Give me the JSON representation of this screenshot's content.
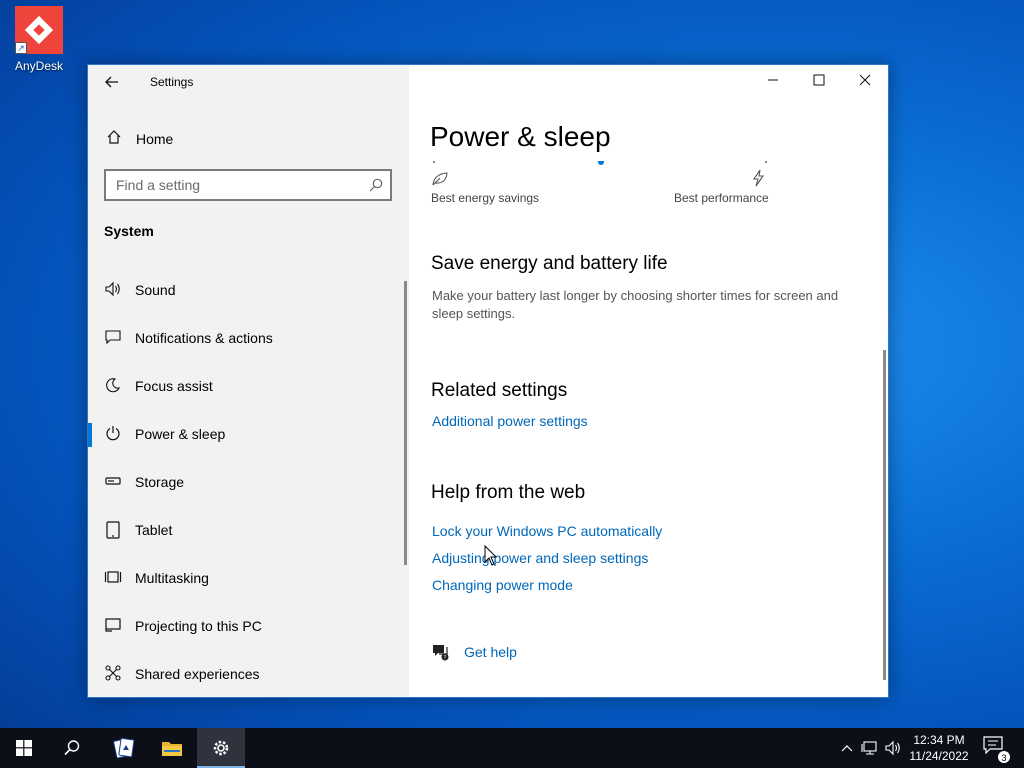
{
  "desktop": {
    "icons": [
      {
        "label": "AnyDesk",
        "icon": "anydesk-icon"
      }
    ]
  },
  "window": {
    "title": "Settings",
    "controls": {
      "minimize": "—",
      "maximize": "☐",
      "close": "✕"
    }
  },
  "sidebar": {
    "home_label": "Home",
    "search_placeholder": "Find a setting",
    "section_label": "System",
    "items": [
      {
        "label": "Sound",
        "icon": "speaker-icon",
        "active": false
      },
      {
        "label": "Notifications & actions",
        "icon": "notification-icon",
        "active": false
      },
      {
        "label": "Focus assist",
        "icon": "moon-icon",
        "active": false
      },
      {
        "label": "Power & sleep",
        "icon": "power-icon",
        "active": true
      },
      {
        "label": "Storage",
        "icon": "storage-icon",
        "active": false
      },
      {
        "label": "Tablet",
        "icon": "tablet-icon",
        "active": false
      },
      {
        "label": "Multitasking",
        "icon": "multitasking-icon",
        "active": false
      },
      {
        "label": "Projecting to this PC",
        "icon": "projector-icon",
        "active": false
      },
      {
        "label": "Shared experiences",
        "icon": "shared-experiences-icon",
        "active": false
      }
    ]
  },
  "main": {
    "page_title": "Power & sleep",
    "power_mode": {
      "left_label": "Best energy savings",
      "right_label": "Best performance"
    },
    "save_energy": {
      "heading": "Save energy and battery life",
      "description": "Make your battery last longer by choosing shorter times for screen and sleep settings."
    },
    "related": {
      "heading": "Related settings",
      "links": [
        "Additional power settings"
      ]
    },
    "help": {
      "heading": "Help from the web",
      "links": [
        "Lock your Windows PC automatically",
        "Adjusting power and sleep settings",
        "Changing power mode"
      ]
    },
    "get_help_label": "Get help"
  },
  "taskbar": {
    "time": "12:34 PM",
    "date": "11/24/2022",
    "notification_count": "3",
    "accent": "#0078d7"
  }
}
